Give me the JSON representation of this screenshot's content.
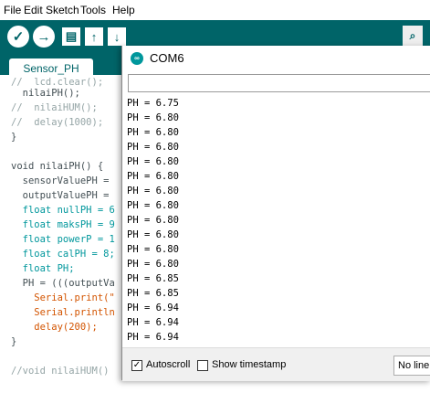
{
  "menu": {
    "file": "File",
    "edit": "Edit",
    "sketch": "Sketch",
    "tools": "Tools",
    "help": "Help"
  },
  "toolbar": {
    "verify": "✓",
    "upload": "→",
    "new": "▤",
    "open": "↑",
    "save": "↓",
    "serial_monitor": "⌕"
  },
  "editor": {
    "tab_label": "Sensor_PH",
    "lines": [
      "//  lcd.clear();",
      "  nilaiPH();",
      "//  nilaiHUM();",
      "//  delay(1000);",
      "}",
      "",
      "void nilaiPH() {",
      "  sensorValuePH =",
      "  outputValuePH =",
      "  float nullPH = 6",
      "  float maksPH = 9",
      "  float powerP = 1",
      "  float calPH = 8;",
      "  float PH;",
      "  PH = (((outputVa",
      "    Serial.print(\"",
      "    Serial.println",
      "    delay(200);",
      "}",
      "",
      "//void nilaiHUM()"
    ]
  },
  "serial_monitor": {
    "title": "COM6",
    "icon": "arduino-icon",
    "input_value": "",
    "output_lines": [
      "PH = 6.75",
      "PH = 6.80",
      "PH = 6.80",
      "PH = 6.80",
      "PH = 6.80",
      "PH = 6.80",
      "PH = 6.80",
      "PH = 6.80",
      "PH = 6.80",
      "PH = 6.80",
      "PH = 6.80",
      "PH = 6.80",
      "PH = 6.85",
      "PH = 6.85",
      "PH = 6.94",
      "PH = 6.94",
      "PH = 6.94"
    ],
    "autoscroll_label": "Autoscroll",
    "autoscroll_checked": true,
    "timestamp_label": "Show timestamp",
    "timestamp_checked": false,
    "line_ending": "No line ending"
  },
  "colors": {
    "toolbar": "#006468",
    "keyword": "#00979c",
    "function": "#d35400",
    "comment": "#95a5a6"
  }
}
